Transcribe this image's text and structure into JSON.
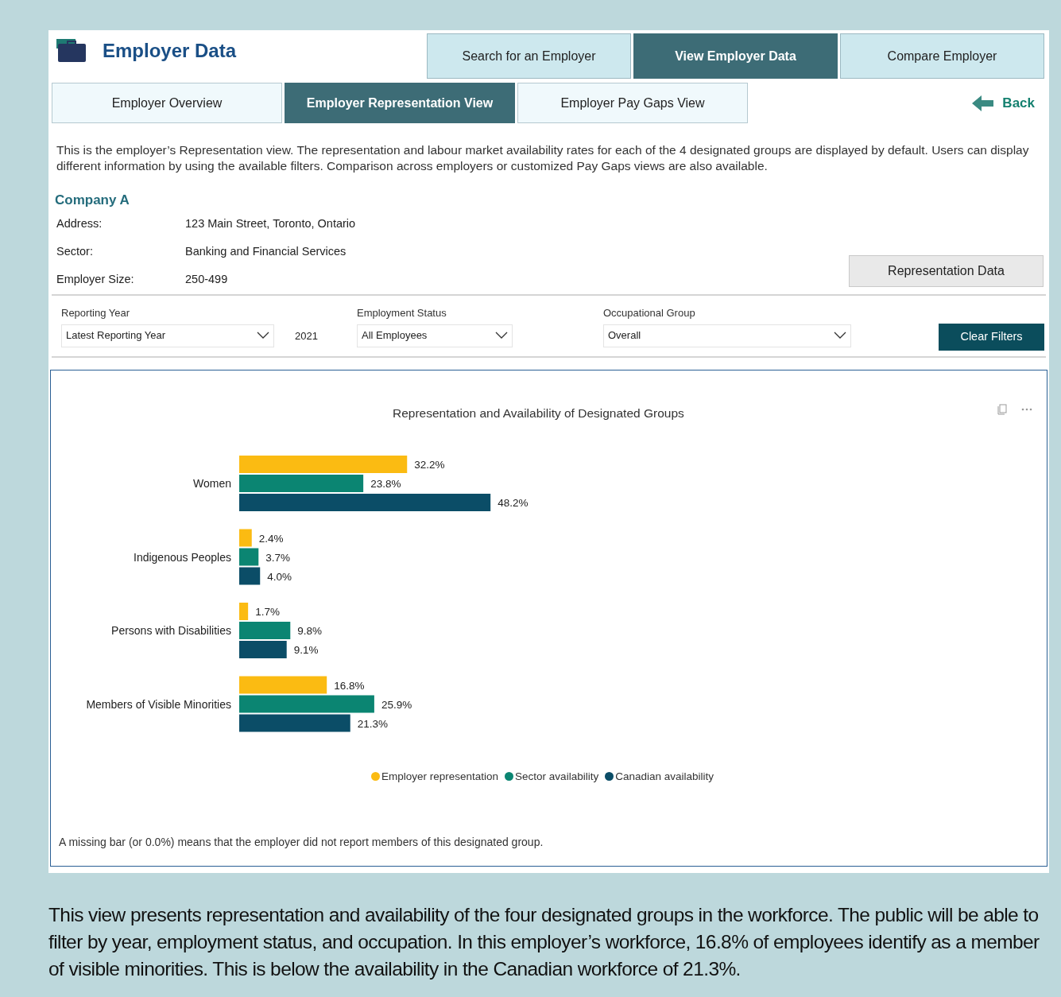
{
  "header": {
    "title": "Employer Data"
  },
  "top_tabs": [
    {
      "label": "Search for an Employer",
      "selected": false
    },
    {
      "label": "View Employer Data",
      "selected": true
    },
    {
      "label": "Compare Employer",
      "selected": false
    }
  ],
  "view_tabs": [
    {
      "label": "Employer Overview",
      "selected": false
    },
    {
      "label": "Employer Representation View",
      "selected": true
    },
    {
      "label": "Employer Pay Gaps View",
      "selected": false
    }
  ],
  "back_link": "Back",
  "intro": "This is the employer’s Representation view. The representation and labour market availability rates for each of the 4 designated groups are displayed by default. Users can display different information by using the available filters. Comparison across employers or customized Pay Gaps views are also available.",
  "company": {
    "name": "Company A",
    "fields": [
      {
        "label": "Address:",
        "value": "123 Main Street, Toronto, Ontario"
      },
      {
        "label": "Sector:",
        "value": "Banking and Financial Services"
      },
      {
        "label": "Employer Size:",
        "value": "250-499"
      }
    ],
    "button": "Representation Data"
  },
  "filters": [
    {
      "label": "Reporting Year",
      "value": "Latest Reporting Year",
      "extra": "2021"
    },
    {
      "label": "Employment Status",
      "value": "All Employees"
    },
    {
      "label": "Occupational Group",
      "value": "Overall"
    }
  ],
  "clear_button": "Clear Filters",
  "chart": {
    "note": "A missing bar (or 0.0%) means that the employer did not report members of this designated group.",
    "chart_data": {
      "type": "bar",
      "orientation": "horizontal",
      "title": "Representation and Availability of Designated Groups",
      "categories": [
        "Women",
        "Indigenous Peoples",
        "Persons with Disabilities",
        "Members of Visible Minorities"
      ],
      "series": [
        {
          "name": "Employer representation",
          "color": "#fbbb12",
          "values": [
            32.2,
            2.4,
            1.7,
            16.8
          ],
          "value_labels": [
            "32.2%",
            "2.4%",
            "1.7%",
            "16.8%"
          ]
        },
        {
          "name": "Sector availability",
          "color": "#0b8572",
          "values": [
            23.8,
            3.7,
            9.8,
            25.9
          ],
          "value_labels": [
            "23.8%",
            "3.7%",
            "9.8%",
            "25.9%"
          ]
        },
        {
          "name": "Canadian availability",
          "color": "#0b4d67",
          "values": [
            48.2,
            4.0,
            9.1,
            21.3
          ],
          "value_labels": [
            "48.2%",
            "4.0%",
            "9.1%",
            "21.3%"
          ]
        }
      ]
    }
  },
  "caption": "This view presents representation and availability of the four designated groups in the workforce. The public will be able to filter by year, employment status, and occupation. In this employer’s workforce, 16.8% of employees identify as a member of visible minorities. This is below the availability in the Canadian workforce of 21.3%."
}
